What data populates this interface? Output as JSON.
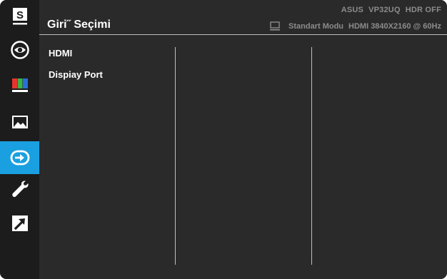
{
  "header": {
    "title": "Giri˝ Seçimi",
    "brand": "ASUS",
    "model": "VP32UQ",
    "hdr": "HDR OFF",
    "mode": "Standart Modu",
    "input_info": "HDMI 3840X2160 @ 60Hz"
  },
  "sidebar": {
    "items": [
      {
        "icon": "splendid-s-icon",
        "glyph": "S"
      },
      {
        "icon": "eye-care-icon"
      },
      {
        "icon": "color-bars-icon"
      },
      {
        "icon": "image-landscape-icon"
      },
      {
        "icon": "input-select-icon",
        "active": true
      },
      {
        "icon": "wrench-icon"
      },
      {
        "icon": "shortcut-arrow-icon"
      }
    ]
  },
  "menu": {
    "items": [
      {
        "label": "HDMI"
      },
      {
        "label": "Dispiay Port"
      }
    ]
  },
  "colors": {
    "background": "#242424",
    "active": "#1aa0e0",
    "text": "#ffffff",
    "status_text": "#8c8c8c",
    "divider": "#bfbfbf"
  }
}
